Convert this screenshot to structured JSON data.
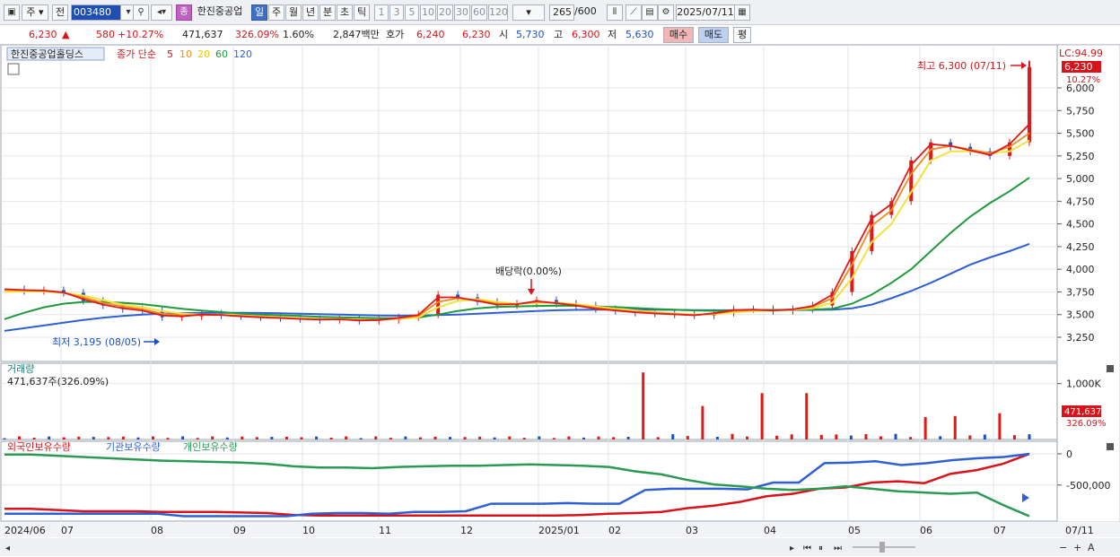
{
  "toolbar": {
    "type_label": "주",
    "range_label": "전",
    "code": "003480",
    "stock_name": "한진중공업",
    "periods": [
      "일",
      "주",
      "월",
      "년",
      "분",
      "초",
      "틱"
    ],
    "active_period": "일",
    "intervals": [
      "1",
      "3",
      "5",
      "10",
      "20",
      "30",
      "60",
      "120"
    ],
    "count": "265",
    "count_max": "/600",
    "date": "2025/07/11"
  },
  "quote": {
    "price": "6,230",
    "arrow": "▲",
    "change": "580",
    "change_pct": "+10.27%",
    "volume": "471,637",
    "volume_ratio": "326.09%",
    "turnover": "1.60%",
    "amount": "2,847백만",
    "ask_label": "호가",
    "ask": "6,240",
    "bid": "6,230",
    "open_label": "시",
    "open": "5,730",
    "high_label": "고",
    "high": "6,300",
    "low_label": "저",
    "low": "5,630",
    "buy_label": "매수",
    "sell_label": "매도",
    "eval_label": "평"
  },
  "colors": {
    "up": "#e01a1a",
    "down": "#1d4fc4",
    "ma5": "#e01a1a",
    "ma10": "#f08a1c",
    "ma20": "#f2e23a",
    "ma60": "#1f9a3a",
    "ma120": "#2f5fd6",
    "foreign": "#d8141a",
    "institution": "#2f5fd6",
    "individual": "#2a9a52"
  },
  "chart_data": [
    {
      "type": "line",
      "title": "한진중공업홀딩스",
      "legend": [
        "종가 단순",
        "5",
        "10",
        "20",
        "60",
        "120"
      ],
      "ylim": [
        3100,
        6450
      ],
      "yticks": [
        "6,000",
        "5,750",
        "5,500",
        "5,250",
        "5,000",
        "4,750",
        "4,500",
        "4,250",
        "4,000",
        "3,750",
        "3,500",
        "3,250"
      ],
      "ytick_values": [
        6000,
        5750,
        5500,
        5250,
        5000,
        4750,
        4500,
        4250,
        4000,
        3750,
        3500,
        3250
      ],
      "lc_label": "LC:94.99",
      "last_price_label": "6,230",
      "last_change_label": "10.27%",
      "annotations": {
        "high": "최고 6,300 (07/11)",
        "low": "최저 3,195 (08/05)",
        "dividend": "배당락(0.00%)"
      },
      "x_labels": [
        "2024/06",
        "07",
        "08",
        "09",
        "10",
        "11",
        "12",
        "2025/01",
        "02",
        "03",
        "04",
        "05",
        "06",
        "07",
        "07/11"
      ],
      "series": [
        {
          "name": "종가",
          "values": [
            3780,
            3760,
            3770,
            3740,
            3650,
            3600,
            3560,
            3540,
            3470,
            3480,
            3510,
            3490,
            3480,
            3470,
            3460,
            3450,
            3440,
            3450,
            3430,
            3440,
            3470,
            3500,
            3720,
            3690,
            3640,
            3600,
            3620,
            3660,
            3620,
            3600,
            3560,
            3540,
            3520,
            3510,
            3500,
            3490,
            3520,
            3560,
            3560,
            3540,
            3560,
            3600,
            3750,
            4200,
            4600,
            4750,
            5200,
            5400,
            5350,
            5300,
            5250,
            5400,
            6230
          ]
        },
        {
          "name": "5",
          "values": [
            3780,
            3770,
            3765,
            3745,
            3670,
            3610,
            3570,
            3545,
            3490,
            3480,
            3500,
            3495,
            3480,
            3470,
            3462,
            3452,
            3445,
            3448,
            3435,
            3440,
            3465,
            3495,
            3690,
            3690,
            3650,
            3610,
            3615,
            3650,
            3625,
            3600,
            3565,
            3545,
            3525,
            3512,
            3502,
            3492,
            3515,
            3550,
            3555,
            3545,
            3558,
            3595,
            3720,
            4150,
            4560,
            4720,
            5150,
            5380,
            5360,
            5310,
            5260,
            5380,
            5600
          ]
        },
        {
          "name": "10",
          "values": [
            3770,
            3765,
            3760,
            3740,
            3690,
            3630,
            3590,
            3560,
            3510,
            3490,
            3495,
            3495,
            3485,
            3475,
            3465,
            3455,
            3448,
            3448,
            3440,
            3440,
            3460,
            3485,
            3640,
            3680,
            3660,
            3620,
            3615,
            3640,
            3630,
            3605,
            3575,
            3550,
            3530,
            3518,
            3505,
            3495,
            3510,
            3540,
            3550,
            3548,
            3556,
            3585,
            3680,
            4050,
            4480,
            4650,
            5050,
            5320,
            5360,
            5320,
            5280,
            5350,
            5500
          ]
        },
        {
          "name": "20",
          "values": [
            3750,
            3755,
            3755,
            3740,
            3710,
            3660,
            3610,
            3580,
            3540,
            3510,
            3500,
            3498,
            3490,
            3480,
            3470,
            3460,
            3452,
            3450,
            3445,
            3442,
            3452,
            3470,
            3580,
            3650,
            3670,
            3640,
            3620,
            3630,
            3630,
            3615,
            3590,
            3565,
            3545,
            3528,
            3512,
            3500,
            3505,
            3525,
            3540,
            3545,
            3552,
            3570,
            3630,
            3900,
            4300,
            4500,
            4850,
            5200,
            5300,
            5300,
            5280,
            5300,
            5420
          ]
        },
        {
          "name": "60",
          "values": [
            3450,
            3520,
            3580,
            3620,
            3640,
            3640,
            3630,
            3615,
            3590,
            3565,
            3545,
            3528,
            3510,
            3500,
            3492,
            3484,
            3476,
            3470,
            3465,
            3460,
            3462,
            3468,
            3500,
            3540,
            3570,
            3585,
            3590,
            3595,
            3598,
            3596,
            3590,
            3582,
            3572,
            3562,
            3554,
            3546,
            3542,
            3545,
            3550,
            3552,
            3554,
            3556,
            3565,
            3620,
            3720,
            3850,
            4000,
            4200,
            4400,
            4580,
            4730,
            4860,
            5010
          ]
        },
        {
          "name": "120",
          "values": [
            3320,
            3350,
            3380,
            3410,
            3440,
            3465,
            3485,
            3500,
            3510,
            3515,
            3518,
            3520,
            3520,
            3518,
            3515,
            3510,
            3505,
            3500,
            3495,
            3490,
            3488,
            3490,
            3495,
            3500,
            3510,
            3520,
            3530,
            3540,
            3548,
            3552,
            3555,
            3556,
            3555,
            3554,
            3552,
            3550,
            3548,
            3548,
            3548,
            3549,
            3550,
            3552,
            3555,
            3570,
            3610,
            3680,
            3760,
            3850,
            3950,
            4050,
            4130,
            4200,
            4280
          ]
        }
      ]
    },
    {
      "type": "bar",
      "title": "거래량",
      "subtitle": "471,637주(326.09%)",
      "yticks": [
        "1,000K"
      ],
      "ytick_values": [
        1000000
      ],
      "ylim": [
        0,
        1300000
      ],
      "last_label": "471,637",
      "last_ratio_label": "326.09%",
      "spikes": [
        {
          "x_index": 43,
          "value": 1200000,
          "color": "up"
        },
        {
          "x_index": 47,
          "value": 600000,
          "color": "up"
        },
        {
          "x_index": 51,
          "value": 830000,
          "color": "up"
        },
        {
          "x_index": 54,
          "value": 830000,
          "color": "up"
        },
        {
          "x_index": 62,
          "value": 400000,
          "color": "up"
        },
        {
          "x_index": 64,
          "value": 420000,
          "color": "up"
        },
        {
          "x_index": 67,
          "value": 471637,
          "color": "up"
        }
      ],
      "baseline_level": 40000
    },
    {
      "type": "line",
      "title": "외국인보유수량",
      "legend": [
        "외국인보유수량",
        "기관보유수량",
        "개인보유수량"
      ],
      "yticks": [
        "0",
        "-500,000"
      ],
      "ytick_values": [
        0,
        -500000
      ],
      "ylim": [
        -1050000,
        100000
      ],
      "series": [
        {
          "name": "외국인보유수량",
          "values": [
            -880000,
            -880000,
            -900000,
            -920000,
            -920000,
            -920000,
            -930000,
            -930000,
            -930000,
            -940000,
            -950000,
            -980000,
            -990000,
            -990000,
            -990000,
            -990000,
            -990000,
            -990000,
            -990000,
            -990000,
            -990000,
            -990000,
            -980000,
            -960000,
            -950000,
            -930000,
            -870000,
            -830000,
            -770000,
            -680000,
            -640000,
            -560000,
            -540000,
            -460000,
            -440000,
            -470000,
            -320000,
            -260000,
            -160000,
            0
          ]
        },
        {
          "name": "기관보유수량",
          "values": [
            -960000,
            -960000,
            -960000,
            -960000,
            -960000,
            -960000,
            -960000,
            -1000000,
            -1000000,
            -1000000,
            -1000000,
            -1000000,
            -960000,
            -950000,
            -950000,
            -960000,
            -930000,
            -930000,
            -920000,
            -800000,
            -800000,
            -800000,
            -790000,
            -800000,
            -800000,
            -580000,
            -560000,
            -560000,
            -560000,
            -570000,
            -460000,
            -460000,
            -150000,
            -140000,
            -120000,
            -180000,
            -150000,
            -100000,
            -70000,
            -50000,
            0
          ]
        },
        {
          "name": "개인보유수량",
          "values": [
            -10000,
            -10000,
            -30000,
            -50000,
            -70000,
            -90000,
            -110000,
            -120000,
            -130000,
            -140000,
            -160000,
            -200000,
            -220000,
            -220000,
            -230000,
            -210000,
            -200000,
            -190000,
            -190000,
            -180000,
            -170000,
            -180000,
            -190000,
            -210000,
            -280000,
            -330000,
            -420000,
            -490000,
            -520000,
            -560000,
            -580000,
            -560000,
            -520000,
            -560000,
            -600000,
            -620000,
            -640000,
            -620000,
            -820000,
            -1000000
          ]
        }
      ]
    }
  ]
}
